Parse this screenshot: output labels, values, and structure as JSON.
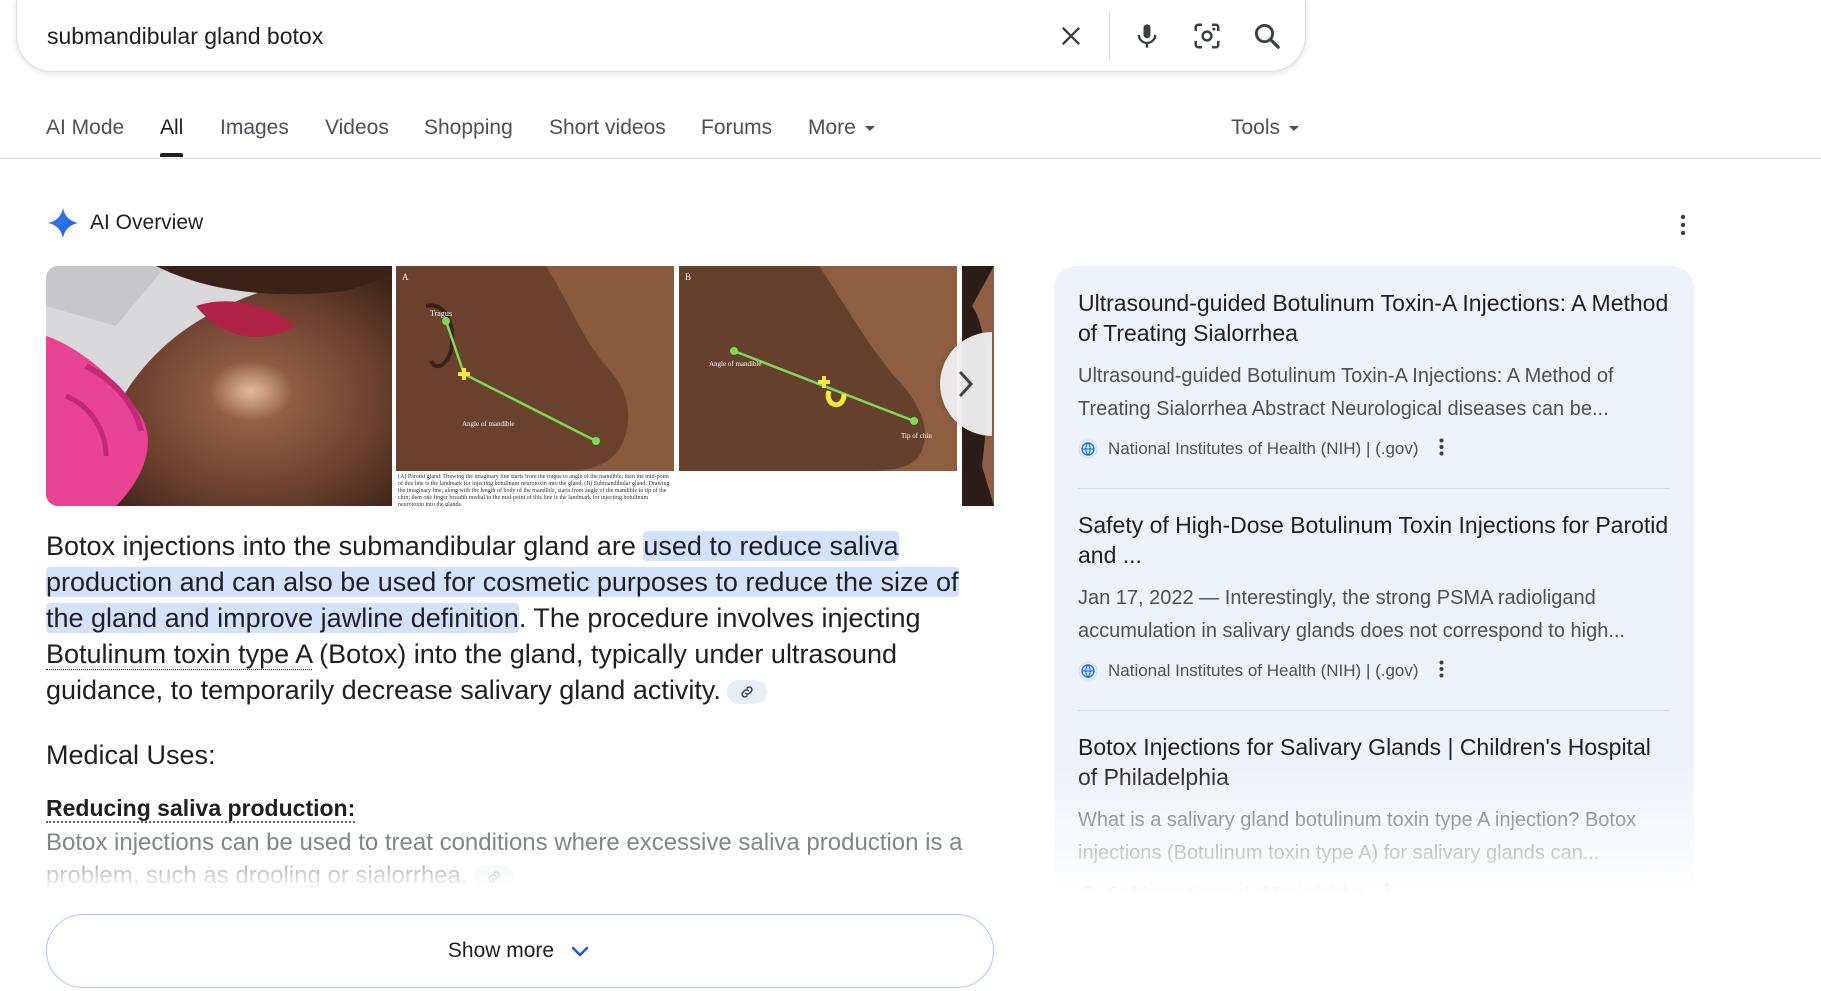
{
  "search": {
    "query": "submandibular gland botox"
  },
  "tabs": [
    {
      "label": "AI Mode"
    },
    {
      "label": "All"
    },
    {
      "label": "Images"
    },
    {
      "label": "Videos"
    },
    {
      "label": "Shopping"
    },
    {
      "label": "Short videos"
    },
    {
      "label": "Forums"
    },
    {
      "label": "More"
    }
  ],
  "tools_label": "Tools",
  "active_tab": "All",
  "overview": {
    "title": "AI Overview",
    "answer": {
      "part1": "Botox injections into the submandibular gland are ",
      "highlight": "used to reduce saliva production and can also be used for cosmetic purposes to reduce the size of the gland and improve jawline definition",
      "part2": ". The procedure involves injecting ",
      "entity": "Botulinum toxin type A",
      "part3": " (Botox) into the gland, typically under ultrasound guidance, to temporarily decrease salivary gland activity."
    },
    "section_title": "Medical Uses:",
    "sub_heading": "Reducing saliva production:",
    "sub_body": "Botox injections can be used to treat conditions where excessive saliva production is a problem, such as drooling or sialorrhea.",
    "show_more": "Show more",
    "image_labels": {
      "panel_a": "A",
      "panel_b": "B",
      "tragus": "Tragus",
      "angle_of_mandible": "Angle of mandible",
      "tip_of_chin": "Tip of chin",
      "caption": "(A) Parotid gland: Drawing the imaginary line starts from the tragus to angle of the mandible; then the mid-point of this line is the landmark for injecting botulinum neurotoxin into the gland. (B) Submandibular gland: Drawing the imaginary line, along with the length of body of the mandible, starts from angle of the mandible to tip of the chin; then one finger breadth medial to the mid-point of this line is the landmark for injecting botulinum neurotoxin into the glands."
    }
  },
  "sources": [
    {
      "title": "Ultrasound-guided Botulinum Toxin-A Injections: A Method of Treating Sialorrhea",
      "snippet": "Ultrasound-guided Botulinum Toxin-A Injections: A Method of Treating Sialorrhea Abstract Neurological diseases can be...",
      "publisher": "National Institutes of Health (NIH) | (.gov)"
    },
    {
      "title": "Safety of High-Dose Botulinum Toxin Injections for Parotid and ...",
      "snippet": "Jan 17, 2022 — Interestingly, the strong PSMA radioligand accumulation in salivary glands does not correspond to high...",
      "publisher": "National Institutes of Health (NIH) | (.gov)"
    },
    {
      "title": "Botox Injections for Salivary Glands | Children's Hospital of Philadelphia",
      "snippet": "What is a salivary gland botulinum toxin type A injection? Botox injections (Botulinum toxin type A) for salivary glands can...",
      "publisher": "Children's Hospital of Philadelphia"
    }
  ],
  "colors": {
    "accent": "#1a73e8",
    "highlight": "#d3e3fd",
    "panel": "#eef2fa",
    "text": "#1f1f1f",
    "muted": "#4d5156"
  },
  "icons": [
    "clear-icon",
    "mic-icon",
    "lens-icon",
    "search-icon",
    "ai-sparkle-icon",
    "kebab-icon",
    "chevron-right-icon",
    "link-icon",
    "chevron-down-icon",
    "globe-icon"
  ]
}
